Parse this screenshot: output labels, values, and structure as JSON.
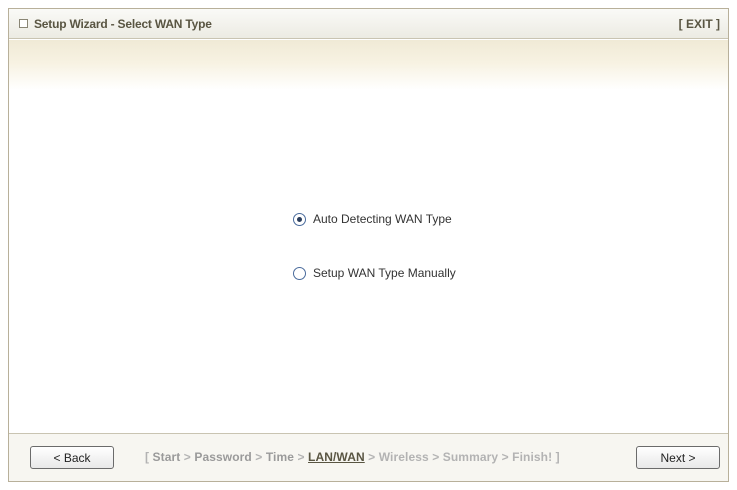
{
  "window": {
    "title": "Setup Wizard - Select WAN Type",
    "exit_label": "[ EXIT ]"
  },
  "options": [
    {
      "label": "Auto Detecting WAN Type",
      "checked": true
    },
    {
      "label": "Setup WAN Type Manually",
      "checked": false
    }
  ],
  "footer": {
    "back_label": "< Back",
    "next_label": "Next >",
    "steps": {
      "open": "[ ",
      "start": "Start",
      "sep": " > ",
      "password": "Password",
      "time": "Time",
      "lanwan": "LAN/WAN",
      "wireless": "Wireless",
      "summary": "Summary",
      "finish": "Finish!",
      "close": " ]",
      "current": "LAN/WAN"
    }
  },
  "colors": {
    "accent": "#595542",
    "band": "#f0ead6",
    "inactive_step": "#b3b3b3"
  }
}
